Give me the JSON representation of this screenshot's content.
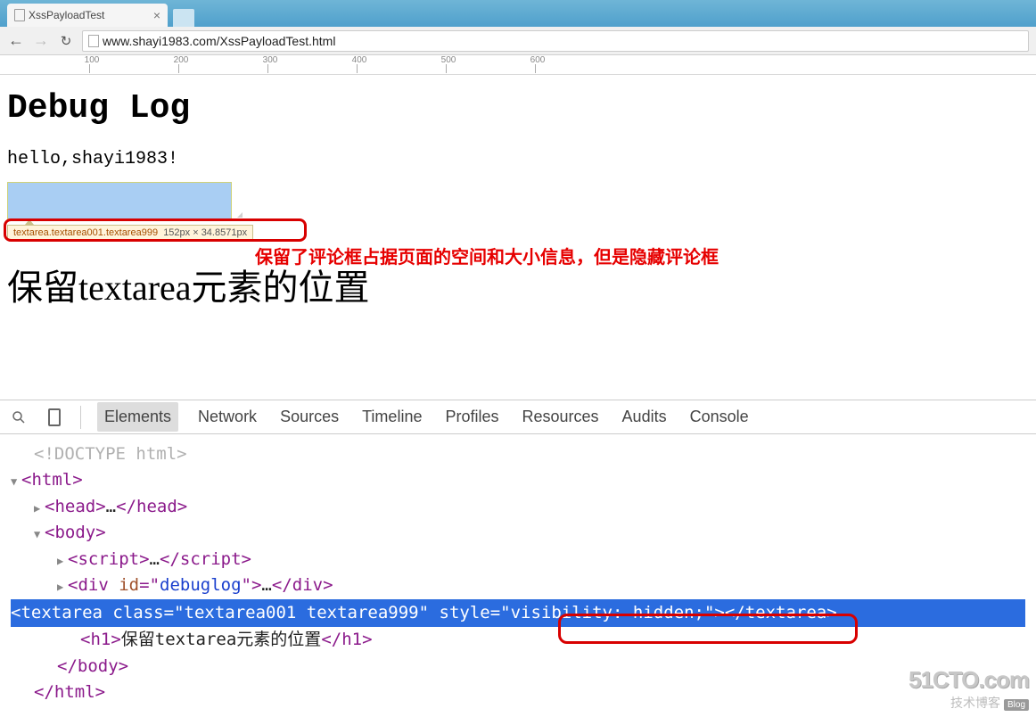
{
  "browser": {
    "tab_title": "XssPayloadTest",
    "url": "www.shayi1983.com/XssPayloadTest.html"
  },
  "ruler_ticks": [
    "100",
    "200",
    "300",
    "400",
    "500",
    "600"
  ],
  "page": {
    "heading": "Debug Log",
    "hello": "hello,shayi1983!",
    "textarea_tooltip_selector": "textarea.textarea001.textarea999",
    "textarea_tooltip_dims": "152px × 34.8571px",
    "red_annotation": "保留了评论框占据页面的空间和大小信息，但是隐藏评论框",
    "heading2": "保留textarea元素的位置"
  },
  "devtools": {
    "tabs": [
      "Elements",
      "Network",
      "Sources",
      "Timeline",
      "Profiles",
      "Resources",
      "Audits",
      "Console"
    ],
    "active_tab": "Elements",
    "dom": {
      "doctype": "<!DOCTYPE html>",
      "html_open": "html",
      "head_open": "head",
      "head_ell": "…",
      "head_close": "head",
      "body_open": "body",
      "script_open": "script",
      "script_ell": "…",
      "script_close": "script",
      "div_open": "div",
      "div_id_attr": "id",
      "div_id_val": "debuglog",
      "div_ell": "…",
      "div_close": "div",
      "ta_open": "textarea",
      "ta_class_attr": "class",
      "ta_class_val": "textarea001 textarea999",
      "ta_style_attr": "style",
      "ta_style_val": "visibility: hidden;",
      "ta_close": "textarea",
      "h1_open": "h1",
      "h1_text": "保留textarea元素的位置",
      "h1_close": "h1",
      "body_close": "body",
      "html_close": "html"
    }
  },
  "watermark": {
    "line1": "51CTO.com",
    "line2": "技术博客",
    "blog": "Blog"
  }
}
